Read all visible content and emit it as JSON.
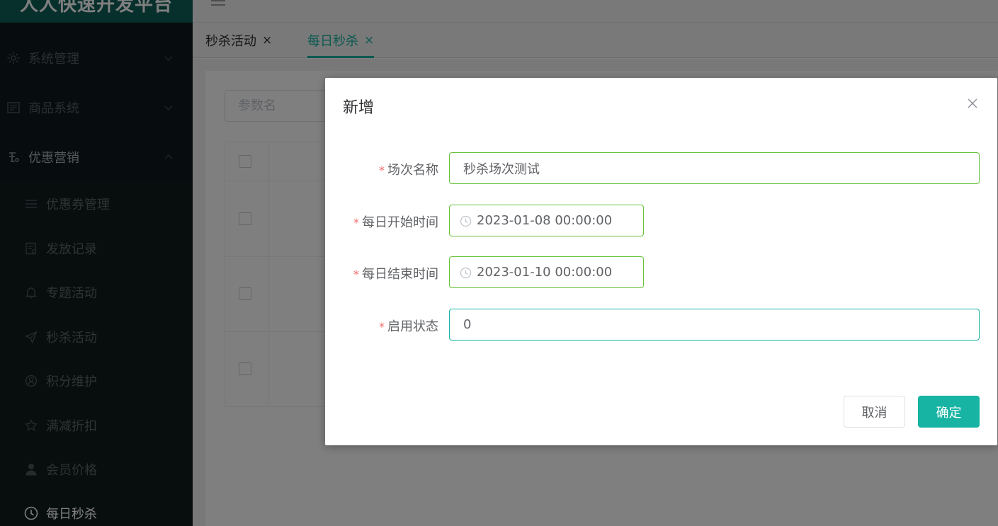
{
  "app": {
    "brand_title": "人人快速开发平台"
  },
  "sidebar": {
    "menus": [
      {
        "label": "系统管理",
        "icon": "gear-icon",
        "expanded": false
      },
      {
        "label": "商品系统",
        "icon": "product-icon",
        "expanded": false
      },
      {
        "label": "优惠营销",
        "icon": "marketing-icon",
        "expanded": true
      }
    ],
    "submenu": [
      {
        "label": "优惠券管理",
        "icon": "list-icon",
        "active": false
      },
      {
        "label": "发放记录",
        "icon": "record-icon",
        "active": false
      },
      {
        "label": "专题活动",
        "icon": "bell-icon",
        "active": false
      },
      {
        "label": "秒杀活动",
        "icon": "send-icon",
        "active": false
      },
      {
        "label": "积分维护",
        "icon": "user-circle-icon",
        "active": false
      },
      {
        "label": "满减折扣",
        "icon": "star-icon",
        "active": false
      },
      {
        "label": "会员价格",
        "icon": "user-icon",
        "active": false
      },
      {
        "label": "每日秒杀",
        "icon": "clock-icon",
        "active": true
      }
    ]
  },
  "tabs": [
    {
      "label": "秒杀活动",
      "close": "×",
      "active": false
    },
    {
      "label": "每日秒杀",
      "close": "×",
      "active": true
    }
  ],
  "main": {
    "search_placeholder": "参数名"
  },
  "dialog": {
    "title": "新增",
    "close_icon": "close-icon",
    "fields": [
      {
        "label": "场次名称",
        "required": "*",
        "value": "秒杀场次测试"
      },
      {
        "label": "每日开始时间",
        "required": "*",
        "value": "2023-01-08 00:00:00"
      },
      {
        "label": "每日结束时间",
        "required": "*",
        "value": "2023-01-10 00:00:00"
      },
      {
        "label": "启用状态",
        "required": "*",
        "value": "0"
      }
    ],
    "cancel_label": "取消",
    "confirm_label": "确定"
  },
  "colors": {
    "accent": "#17b3a3",
    "valid_border": "#67c23a",
    "required": "#f56c6c",
    "sidebar_bg": "#0f1a1c"
  }
}
